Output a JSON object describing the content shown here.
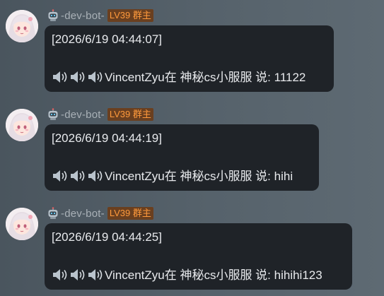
{
  "messages": [
    {
      "avatar_icon": "anime-girl-avatar",
      "bot_icon": "robot-icon",
      "username": "-dev-bot-",
      "badge": "LV39 群主",
      "timestamp": "[2026/6/19 04:44:07]",
      "speaker_icons": [
        "speaker-icon",
        "speaker-icon",
        "speaker-icon"
      ],
      "body_text": "VincentZyu在 神秘cs小服服 说: 11122"
    },
    {
      "avatar_icon": "anime-girl-avatar",
      "bot_icon": "robot-icon",
      "username": "-dev-bot-",
      "badge": "LV39 群主",
      "timestamp": "[2026/6/19 04:44:19]",
      "speaker_icons": [
        "speaker-icon",
        "speaker-icon",
        "speaker-icon"
      ],
      "body_text": "VincentZyu在 神秘cs小服服 说: hihi"
    },
    {
      "avatar_icon": "anime-girl-avatar",
      "bot_icon": "robot-icon",
      "username": "-dev-bot-",
      "badge": "LV39 群主",
      "timestamp": "[2026/6/19 04:44:25]",
      "speaker_icons": [
        "speaker-icon",
        "speaker-icon",
        "speaker-icon"
      ],
      "body_text": "VincentZyu在 神秘cs小服服 说: hihihi123"
    }
  ],
  "colors": {
    "background": "#56626b",
    "bubble": "#1f2328",
    "bubble_text": "#e8eaed",
    "username": "#a9b1b7",
    "badge_bg": "#6a3f1f",
    "badge_text": "#ff9a3c"
  }
}
